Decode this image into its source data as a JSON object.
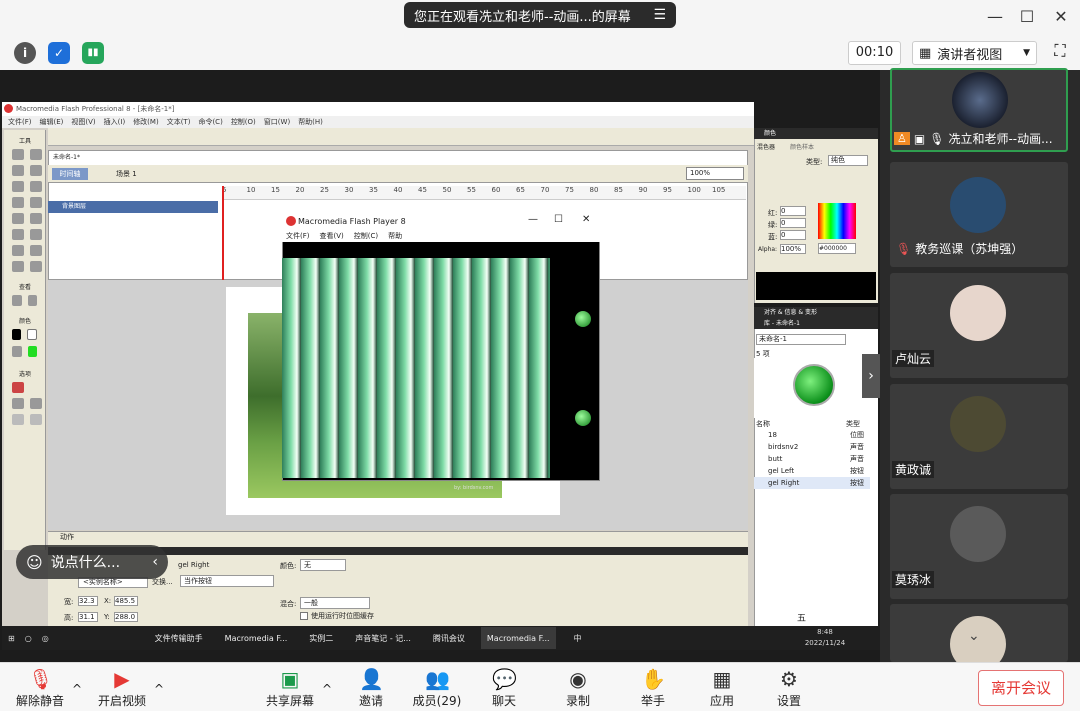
{
  "top": {
    "share_banner": "您正在观看冼立和老师--动画...的屏幕",
    "timer": "00:10",
    "view_mode": "演讲者视图"
  },
  "flash": {
    "title": "Macromedia Flash Professional 8 - [未命名-1*]",
    "menu": [
      "文件(F)",
      "编辑(E)",
      "视图(V)",
      "插入(I)",
      "修改(M)",
      "文本(T)",
      "命令(C)",
      "控制(O)",
      "窗口(W)",
      "帮助(H)"
    ],
    "doc_tab": "未命名-1*",
    "timeline_btn": "时间轴",
    "scene": "场景 1",
    "zoom": "100%",
    "layer": "背景图层",
    "ruler": [
      "5",
      "10",
      "15",
      "20",
      "25",
      "30",
      "35",
      "40",
      "45",
      "50",
      "55",
      "60",
      "65",
      "70",
      "75",
      "80",
      "85",
      "90",
      "95",
      "100",
      "105"
    ],
    "tools_label": "工具",
    "view_label": "查看",
    "colors_label": "颜色",
    "options_label": "选项",
    "actions_label": "动作",
    "props": {
      "symbol_name": "gel Right",
      "instance_name": "<实例名称>",
      "swap": "交换...",
      "type": "当作按钮",
      "color_label": "颜色:",
      "color_value": "无",
      "blend_label": "混合:",
      "blend_value": "一般",
      "cache_label": "使用运行时位图缓存",
      "w_label": "宽:",
      "w": "32.3",
      "h_label": "高:",
      "h": "31.1",
      "x_label": "X:",
      "x": "485.5",
      "y_label": "Y:",
      "y": "288.0"
    },
    "color_panel": {
      "title": "颜色",
      "tabs": [
        "混色器",
        "颜色样本"
      ],
      "type_label": "类型:",
      "type_value": "纯色",
      "r_label": "红:",
      "r": "0",
      "g_label": "绿:",
      "g": "0",
      "b_label": "蓝:",
      "b": "0",
      "alpha_label": "Alpha:",
      "alpha": "100%",
      "hex": "#000000"
    },
    "align_panel": "对齐 & 信息 & 变形",
    "library": {
      "title": "库 - 未命名-1",
      "doc": "未命名-1",
      "count": "5 项",
      "col_name": "名称",
      "col_type": "类型",
      "items": [
        {
          "name": "18",
          "type": "位图"
        },
        {
          "name": "birdsnv2",
          "type": "声音"
        },
        {
          "name": "butt",
          "type": "声音"
        },
        {
          "name": "gel Left",
          "type": "按钮"
        },
        {
          "name": "gel Right",
          "type": "按钮"
        }
      ]
    }
  },
  "player": {
    "title": "Macromedia Flash Player 8",
    "menu": [
      "文件(F)",
      "查看(V)",
      "控制(C)",
      "帮助"
    ],
    "credit": "by: birdsnv.com"
  },
  "chat_pill": "说点什么...",
  "taskbar": {
    "items": [
      "文件传输助手",
      "Macromedia F...",
      "实例二",
      "声音笔记 - 记...",
      "腾讯会议",
      "Macromedia F..."
    ],
    "time": "8:48",
    "date": "2022/11/24",
    "ime": "中",
    "ime2": "五"
  },
  "participants": [
    {
      "name": "冼立和老师--动画..."
    },
    {
      "name": "教务巡课（苏坤强）"
    },
    {
      "name": "卢灿云"
    },
    {
      "name": "黄政诚"
    },
    {
      "name": "莫琇冰"
    }
  ],
  "controls": {
    "mute": "解除静音",
    "video": "开启视频",
    "share": "共享屏幕",
    "invite": "邀请",
    "members": "成员(29)",
    "chat": "聊天",
    "record": "录制",
    "raise": "举手",
    "apps": "应用",
    "settings": "设置",
    "leave": "离开会议"
  }
}
